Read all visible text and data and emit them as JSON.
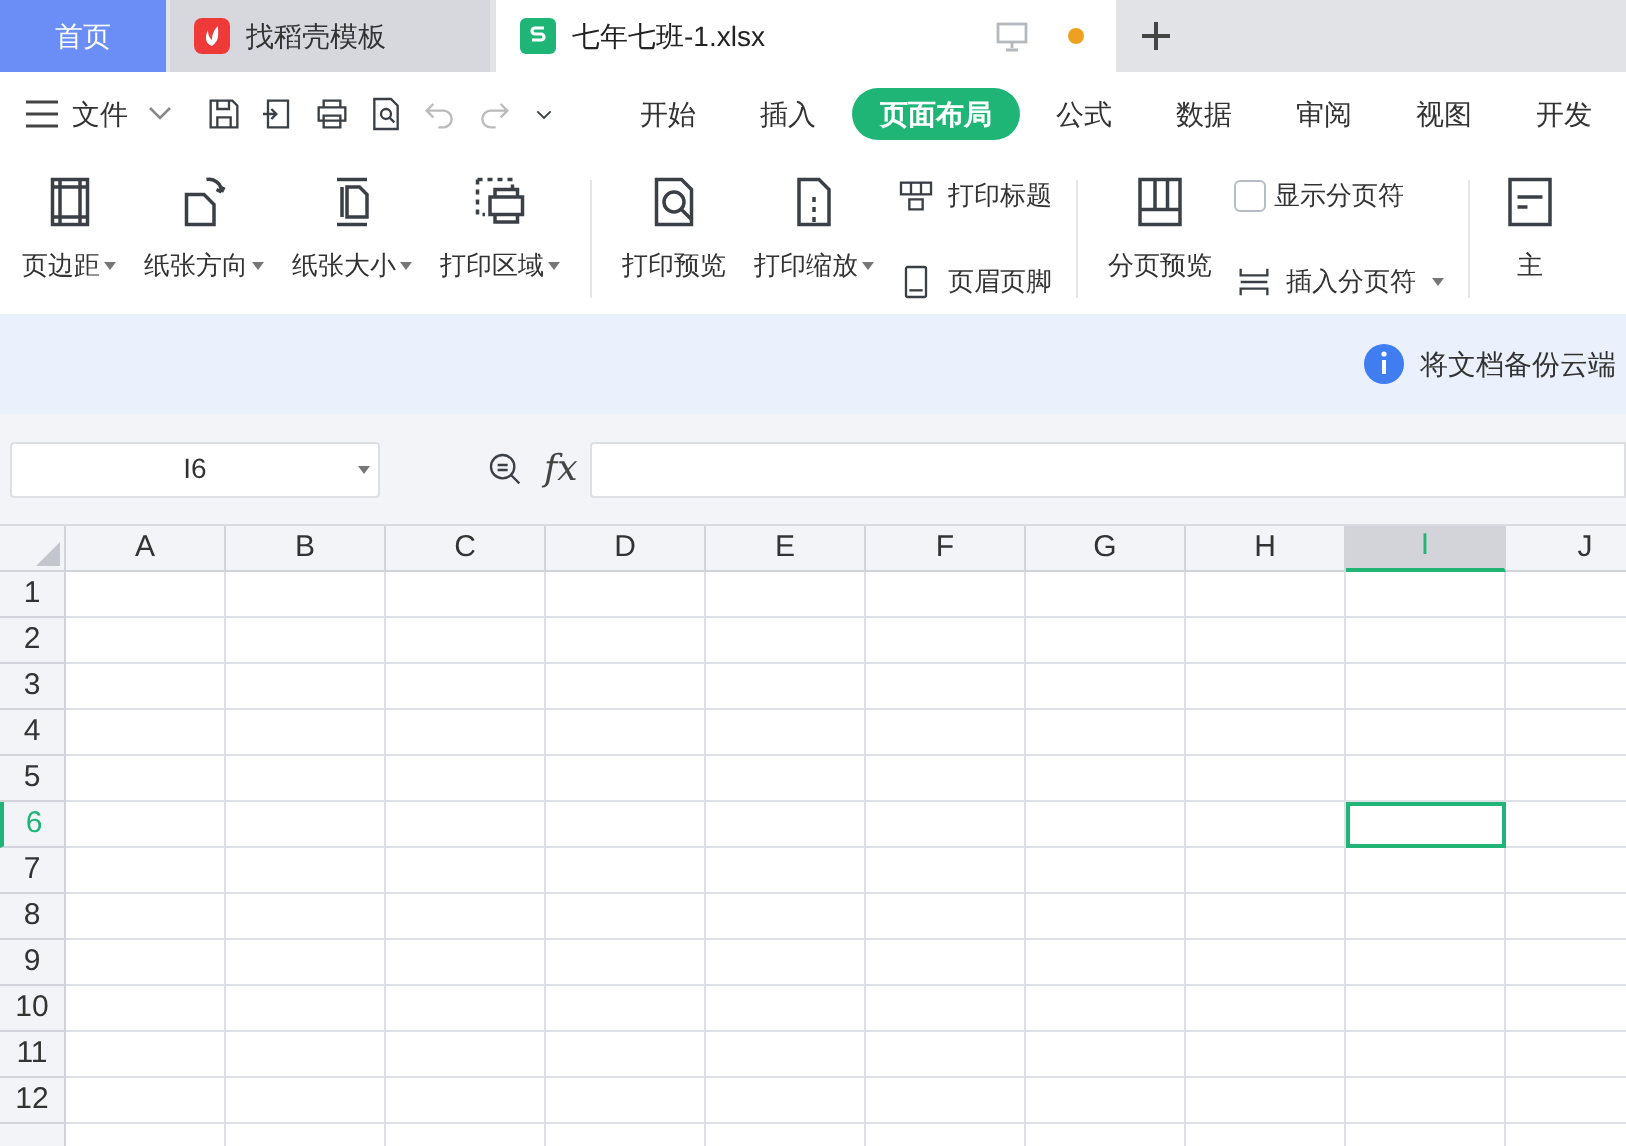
{
  "tabs": [
    {
      "kind": "home",
      "label": "首页",
      "selected": false
    },
    {
      "kind": "template",
      "label": "找稻壳模板",
      "selected": false
    },
    {
      "kind": "sheet",
      "label": "七年七班-1.xlsx",
      "selected": true,
      "unsaved": true
    }
  ],
  "menu": {
    "file_label": "文件",
    "ribbon_tabs": [
      {
        "label": "开始",
        "selected": false
      },
      {
        "label": "插入",
        "selected": false
      },
      {
        "label": "页面布局",
        "selected": true
      },
      {
        "label": "公式",
        "selected": false
      },
      {
        "label": "数据",
        "selected": false
      },
      {
        "label": "审阅",
        "selected": false
      },
      {
        "label": "视图",
        "selected": false
      },
      {
        "label": "开发",
        "selected": false
      }
    ]
  },
  "ribbon": [
    {
      "kind": "big",
      "label": "页边距",
      "dropdown": true
    },
    {
      "kind": "big",
      "label": "纸张方向",
      "dropdown": true
    },
    {
      "kind": "big",
      "label": "纸张大小",
      "dropdown": true
    },
    {
      "kind": "big",
      "label": "打印区域",
      "dropdown": true
    },
    {
      "kind": "divider"
    },
    {
      "kind": "big",
      "label": "打印预览",
      "dropdown": false
    },
    {
      "kind": "big",
      "label": "打印缩放",
      "dropdown": true
    },
    {
      "kind": "stack",
      "items": [
        {
          "kind": "button",
          "label": "打印标题",
          "dropdown": false
        },
        {
          "kind": "button",
          "label": "页眉页脚",
          "dropdown": false
        }
      ]
    },
    {
      "kind": "divider"
    },
    {
      "kind": "big",
      "label": "分页预览",
      "dropdown": false
    },
    {
      "kind": "stack",
      "items": [
        {
          "kind": "check",
          "label": "显示分页符",
          "checked": false
        },
        {
          "kind": "button",
          "label": "插入分页符",
          "dropdown": true
        }
      ]
    },
    {
      "kind": "divider"
    },
    {
      "kind": "big",
      "label": "主",
      "dropdown": false
    }
  ],
  "notice": "将文档备份云端",
  "formula_bar": {
    "name_box": "I6",
    "fx": "fx"
  },
  "grid": {
    "columns": [
      {
        "label": "A",
        "selected": false
      },
      {
        "label": "B",
        "selected": false
      },
      {
        "label": "C",
        "selected": false
      },
      {
        "label": "D",
        "selected": false
      },
      {
        "label": "E",
        "selected": false
      },
      {
        "label": "F",
        "selected": false
      },
      {
        "label": "G",
        "selected": false
      },
      {
        "label": "H",
        "selected": false
      },
      {
        "label": "I",
        "selected": true
      },
      {
        "label": "J",
        "selected": false
      }
    ],
    "rows": [
      {
        "label": "1",
        "selected": false
      },
      {
        "label": "2",
        "selected": false
      },
      {
        "label": "3",
        "selected": false
      },
      {
        "label": "4",
        "selected": false
      },
      {
        "label": "5",
        "selected": false
      },
      {
        "label": "6",
        "selected": true
      },
      {
        "label": "7",
        "selected": false
      },
      {
        "label": "8",
        "selected": false
      },
      {
        "label": "9",
        "selected": false
      },
      {
        "label": "10",
        "selected": false
      },
      {
        "label": "11",
        "selected": false
      },
      {
        "label": "12",
        "selected": false
      }
    ]
  }
}
